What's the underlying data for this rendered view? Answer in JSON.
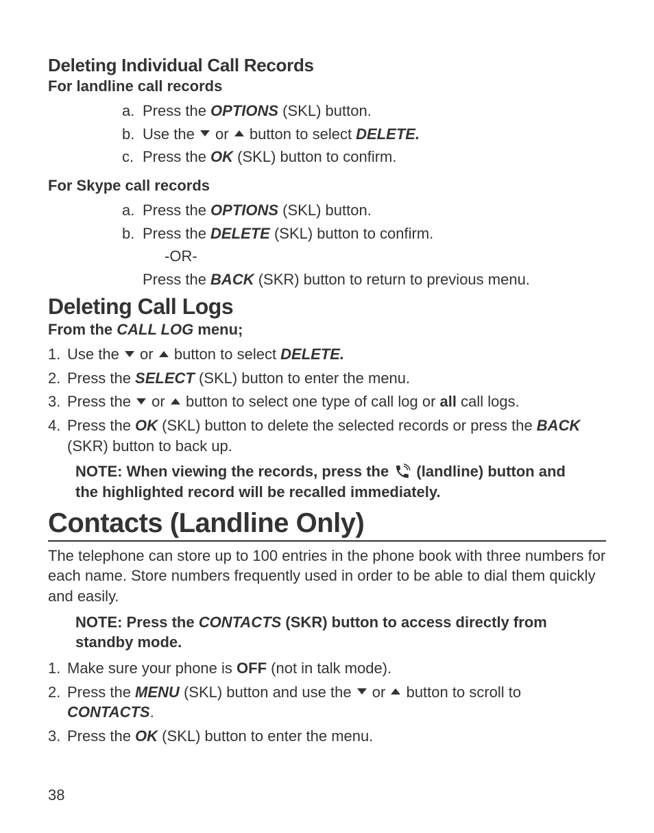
{
  "s1": {
    "heading": "Deleting Individual Call Records",
    "sub1": "For landline call records",
    "a1": {
      "l": "a.",
      "pre": "Press the ",
      "k": "OPTIONS",
      "post": " (SKL) button."
    },
    "b1": {
      "l": "b.",
      "pre": "Use the ",
      "mid": " or ",
      "post": "  button to select ",
      "k": "DELETE."
    },
    "c1": {
      "l": "c.",
      "pre": "Press the ",
      "k": "OK",
      "post": " (SKL) button to confirm."
    },
    "sub2": "For Skype call records",
    "a2": {
      "l": "a.",
      "pre": "Press the ",
      "k": "OPTIONS",
      "post": " (SKL) button."
    },
    "b2": {
      "l": "b.",
      "pre": "Press the ",
      "k": "DELETE",
      "post": " (SKL) button to confirm."
    },
    "or": "-OR-",
    "back": {
      "pre": "Press the ",
      "k": "BACK",
      "post": " (SKR) button to return to previous menu."
    }
  },
  "s2": {
    "heading": "Deleting Call Logs",
    "sub": {
      "pre": "From the ",
      "k": "CALL LOG",
      "post": " menu;"
    },
    "n1": {
      "n": "1.",
      "pre": "Use the ",
      "mid": " or ",
      "post": "  button to select ",
      "k": "DELETE."
    },
    "n2": {
      "n": "2.",
      "pre": "Press the ",
      "k": "SELECT",
      "post": " (SKL) button to enter the menu."
    },
    "n3": {
      "n": "3.",
      "pre": "Press the  ",
      "mid": " or ",
      "post": "  button to select one type of call log or ",
      "k": "all",
      "post2": " call logs."
    },
    "n4": {
      "n": "4.",
      "pre": "Press the ",
      "k1": "OK",
      "mid": " (SKL) button to delete the selected records or press the ",
      "k2": "BACK",
      "post": " (SKR) button to back up."
    },
    "note": {
      "pre": "NOTE: When viewing the records, press the ",
      "post": " (landline) button and the highlighted record will be recalled immediately."
    }
  },
  "s3": {
    "heading": "Contacts (Landline Only)",
    "para": "The telephone can store up to 100 entries in the phone book with three numbers for each name. Store numbers frequently used in order to be able to dial them quickly and easily.",
    "note": {
      "pre": "NOTE: Press the ",
      "k": "CONTACTS",
      "post": " (SKR) button to access directly from standby mode."
    },
    "n1": {
      "n": "1.",
      "pre": "Make sure your phone is ",
      "k": "OFF",
      "post": " (not in talk mode)."
    },
    "n2": {
      "n": "2.",
      "pre": "Press the ",
      "k1": "MENU",
      "mid1": " (SKL) button and use the ",
      "mid2": " or ",
      "mid3": " button to scroll to ",
      "k2": "CONTACTS",
      "post": "."
    },
    "n3": {
      "n": "3.",
      "pre": "Press the ",
      "k": "OK",
      "post": " (SKL) button to enter the menu."
    }
  },
  "page": "38"
}
